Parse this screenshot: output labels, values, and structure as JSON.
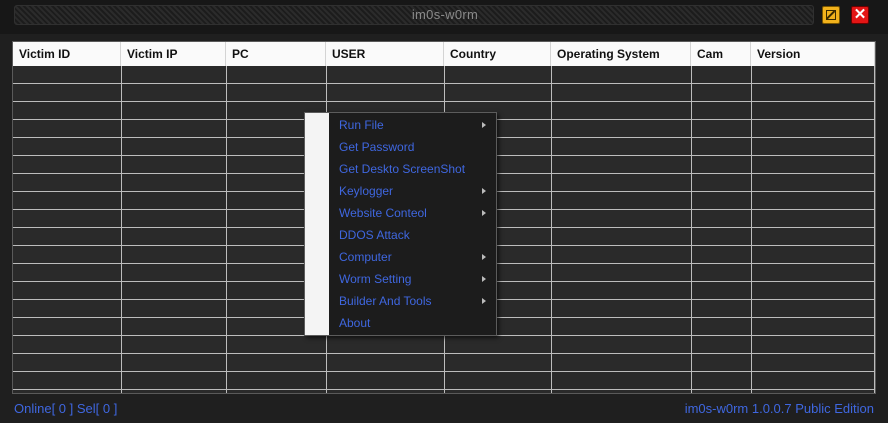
{
  "window": {
    "title": "im0s-w0rm",
    "close_glyph": "✕",
    "maximize_icon": "maximize-icon",
    "close_icon": "close-icon"
  },
  "grid": {
    "columns": [
      "Victim ID",
      "Victim IP",
      "PC",
      "USER",
      "Country",
      "Operating System",
      "Cam",
      "Version"
    ],
    "rows": []
  },
  "context_menu": {
    "items": [
      {
        "label": "Run File",
        "has_submenu": true
      },
      {
        "label": "Get Password",
        "has_submenu": false
      },
      {
        "label": "Get Deskto ScreenShot",
        "has_submenu": false
      },
      {
        "label": "Keylogger",
        "has_submenu": true
      },
      {
        "label": "Website Conteol",
        "has_submenu": true
      },
      {
        "label": "DDOS Attack",
        "has_submenu": false
      },
      {
        "label": "Computer",
        "has_submenu": true
      },
      {
        "label": "Worm Setting",
        "has_submenu": true
      },
      {
        "label": "Builder And Tools",
        "has_submenu": true
      },
      {
        "label": "About",
        "has_submenu": false
      }
    ]
  },
  "status": {
    "left": "Online[ 0 ] Sel[ 0 ]",
    "right": "im0s-w0rm 1.0.0.7 Public Edition"
  },
  "colors": {
    "background": "#1f1f1f",
    "menu_text": "#3f67e0",
    "maximize_button": "#f2b21c",
    "close_button": "#e31515",
    "grid_header": "#fafafa",
    "grid_lines": "#bdbdbd"
  }
}
